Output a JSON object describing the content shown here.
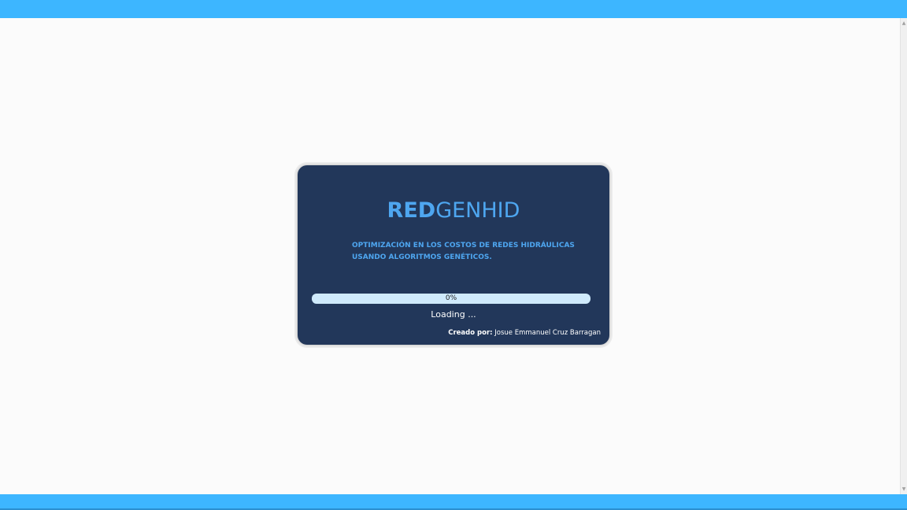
{
  "app": {
    "brand_bold": "RED",
    "brand_light": "GENHID",
    "subtitle_line1": "OPTIMIZACIÓN EN LOS COSTOS DE REDES HIDRÁULICAS",
    "subtitle_line2": "USANDO ALGORITMOS GENÉTICOS."
  },
  "progress": {
    "value_percent": 0,
    "text": "0%"
  },
  "status": {
    "loading_text": "Loading ..."
  },
  "credit": {
    "label": "Creado por:",
    "author": "Josue Emmanuel Cruz Barragan"
  },
  "colors": {
    "frame_bar": "#3db6ff",
    "card_background": "#22375a",
    "accent": "#4ea6f0",
    "progress_track": "#cfeafc",
    "page_background": "#fbfbfb"
  },
  "scrollbar": {
    "up_icon": "scroll-up-arrow-icon",
    "down_icon": "scroll-down-arrow-icon"
  }
}
